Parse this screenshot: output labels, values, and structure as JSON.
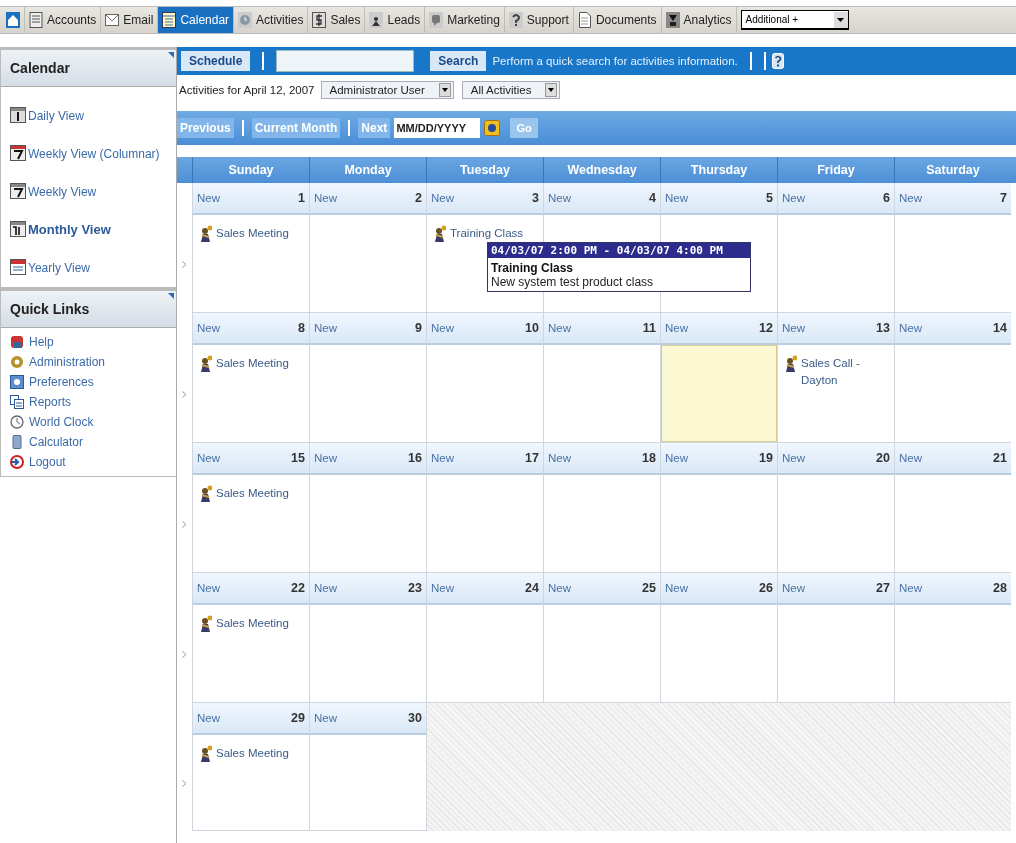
{
  "nav_tabs": [
    {
      "selected": false
    },
    {
      "label": "Accounts",
      "selected": false
    },
    {
      "label": "Email",
      "selected": false
    },
    {
      "label": "Calendar",
      "selected": true
    },
    {
      "label": "Activities",
      "selected": false
    },
    {
      "label": "Sales",
      "selected": false
    },
    {
      "label": "Leads",
      "selected": false
    },
    {
      "label": "Marketing",
      "selected": false
    },
    {
      "label": "Support",
      "selected": false
    },
    {
      "label": "Documents",
      "selected": false
    },
    {
      "label": "Analytics",
      "selected": false
    }
  ],
  "additional_select": {
    "value": "Additional +"
  },
  "sidebar": {
    "calendar_panel": {
      "title": "Calendar",
      "items": [
        {
          "label": "Daily View",
          "selected": false
        },
        {
          "label": "Weekly View (Columnar)",
          "selected": false
        },
        {
          "label": "Weekly View",
          "selected": false
        },
        {
          "label": "Monthly View",
          "selected": true
        },
        {
          "label": "Yearly View",
          "selected": false
        }
      ]
    },
    "quick_links": {
      "title": "Quick Links",
      "items": [
        "Help",
        "Administration",
        "Preferences",
        "Reports",
        "World Clock",
        "Calculator",
        "Logout"
      ]
    }
  },
  "toolbar": {
    "schedule_button": "Schedule",
    "search_button": "Search",
    "search_hint": "Perform a quick search for activities information."
  },
  "filter": {
    "label": "Activities for April 12, 2007",
    "user_select": "Administrator User",
    "type_select": "All Activities"
  },
  "navigation": {
    "previous": "Previous",
    "current_month": "Current Month",
    "next": "Next",
    "date_field": "MM/DD/YYYY",
    "go_button": "Go"
  },
  "calendar": {
    "weekdays": [
      "Sunday",
      "Monday",
      "Tuesday",
      "Wednesday",
      "Thursday",
      "Friday",
      "Saturday"
    ],
    "weeks": [
      {
        "days": [
          {
            "new_label": "New",
            "number": "1",
            "today": false,
            "events": [
              {
                "title": "Sales Meeting"
              }
            ]
          },
          {
            "new_label": "New",
            "number": "2",
            "today": false
          },
          {
            "new_label": "New",
            "number": "3",
            "today": false,
            "events": [
              {
                "title": "Training Class",
                "tooltip": {
                  "time": "04/03/07 2:00 PM - 04/03/07 4:00 PM",
                  "title": "Training Class",
                  "description": "New system test product class"
                }
              }
            ]
          },
          {
            "new_label": "New",
            "number": "4",
            "today": false
          },
          {
            "new_label": "New",
            "number": "5",
            "today": false
          },
          {
            "new_label": "New",
            "number": "6",
            "today": false
          },
          {
            "new_label": "New",
            "number": "7",
            "today": false
          }
        ]
      },
      {
        "days": [
          {
            "new_label": "New",
            "number": "8",
            "today": false,
            "events": [
              {
                "title": "Sales Meeting"
              }
            ]
          },
          {
            "new_label": "New",
            "number": "9",
            "today": false
          },
          {
            "new_label": "New",
            "number": "10",
            "today": false
          },
          {
            "new_label": "New",
            "number": "11",
            "today": false
          },
          {
            "new_label": "New",
            "number": "12",
            "today": true
          },
          {
            "new_label": "New",
            "number": "13",
            "today": false,
            "events": [
              {
                "title": "Sales Call - Dayton"
              }
            ]
          },
          {
            "new_label": "New",
            "number": "14",
            "today": false
          }
        ]
      },
      {
        "days": [
          {
            "new_label": "New",
            "number": "15",
            "today": false,
            "events": [
              {
                "title": "Sales Meeting"
              }
            ]
          },
          {
            "new_label": "New",
            "number": "16",
            "today": false
          },
          {
            "new_label": "New",
            "number": "17",
            "today": false
          },
          {
            "new_label": "New",
            "number": "18",
            "today": false
          },
          {
            "new_label": "New",
            "number": "19",
            "today": false
          },
          {
            "new_label": "New",
            "number": "20",
            "today": false
          },
          {
            "new_label": "New",
            "number": "21",
            "today": false
          }
        ]
      },
      {
        "days": [
          {
            "new_label": "New",
            "number": "22",
            "today": false,
            "events": [
              {
                "title": "Sales Meeting"
              }
            ]
          },
          {
            "new_label": "New",
            "number": "23",
            "today": false
          },
          {
            "new_label": "New",
            "number": "24",
            "today": false
          },
          {
            "new_label": "New",
            "number": "25",
            "today": false
          },
          {
            "new_label": "New",
            "number": "26",
            "today": false
          },
          {
            "new_label": "New",
            "number": "27",
            "today": false
          },
          {
            "new_label": "New",
            "number": "28",
            "today": false
          }
        ]
      },
      {
        "days": [
          {
            "new_label": "New",
            "number": "29",
            "today": false,
            "events": [
              {
                "title": "Sales Meeting"
              }
            ]
          },
          {
            "new_label": "New",
            "number": "30",
            "today": false
          }
        ]
      }
    ]
  }
}
